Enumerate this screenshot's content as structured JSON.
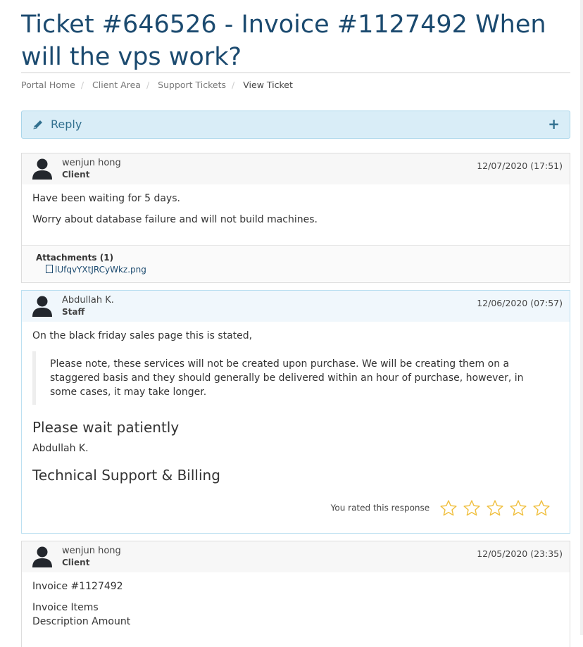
{
  "page_title": "Ticket #646526 - Invoice #1127492 When will the vps work?",
  "breadcrumb": [
    "Portal Home",
    "Client Area",
    "Support Tickets",
    "View Ticket"
  ],
  "reply": {
    "label": "Reply",
    "expand_symbol": "+",
    "icon": "pencil-icon"
  },
  "messages": [
    {
      "name": "wenjun hong",
      "role": "Client",
      "date": "12/07/2020 (17:51)",
      "paragraphs": [
        "Have been waiting for 5 days.",
        "Worry about database failure and will not build machines."
      ],
      "attachments_heading": "Attachments (1)",
      "attachment": "lUfqvYXtJRCyWkz.png"
    },
    {
      "name": "Abdullah K.",
      "role": "Staff",
      "date": "12/06/2020 (07:57)",
      "intro": "On the black friday sales page this is stated,",
      "quote": "Please note, these services will not be created upon purchase. We will be creating them on a staggered basis and they should generally be delivered within an hour of purchase, however, in some cases, it may take longer.",
      "heading1": "Please wait patiently",
      "signature": "Abdullah K.",
      "heading2": "Technical Support & Billing",
      "rating_text": "You rated this response",
      "rating_value": 0,
      "rating_max": 5
    },
    {
      "name": "wenjun hong",
      "role": "Client",
      "date": "12/05/2020 (23:35)",
      "lines": [
        "Invoice #1127492",
        "Invoice Items",
        "Description Amount"
      ]
    }
  ],
  "colors": {
    "title": "#1b4a6f",
    "reply_bg": "#d9edf7",
    "star": "#f0c040"
  }
}
